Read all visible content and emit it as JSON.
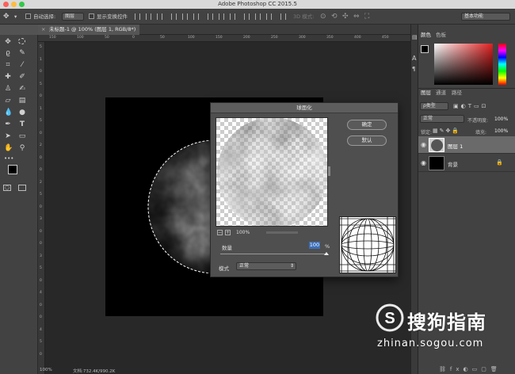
{
  "app": {
    "window_title": "Adobe Photoshop CC 2015.5"
  },
  "options_bar": {
    "auto_select_label": "自动选择:",
    "auto_select_value": "图层",
    "show_transform_label": "显示变换控件",
    "mode_3d_label": "3D 模式:",
    "workspace": "基本功能"
  },
  "document_tab": {
    "title": "未标题-1 @ 100% (图层 1, RGB/8*) *"
  },
  "rulers": {
    "h_ticks": [
      "150",
      "100",
      "50",
      "0",
      "50",
      "100",
      "150",
      "200",
      "250",
      "300",
      "350",
      "400",
      "450"
    ],
    "v_ticks": [
      "5",
      "1",
      "0",
      "5",
      "0",
      "1",
      "5",
      "0",
      "2",
      "0",
      "0",
      "2",
      "5",
      "0",
      "3",
      "0",
      "0",
      "3",
      "5",
      "0",
      "4",
      "0",
      "0",
      "4",
      "5",
      "0"
    ]
  },
  "dialog": {
    "title": "球面化",
    "ok_label": "确定",
    "reset_label": "默认",
    "zoom_level": "100%",
    "amount_label": "数量",
    "amount_value": "100",
    "amount_unit": "%",
    "mode_label": "模式",
    "mode_value": "正常"
  },
  "color_panel": {
    "tab_color": "颜色",
    "tab_swatches": "色板",
    "accent": "#e02020"
  },
  "layers_panel": {
    "tab_layers": "图层",
    "tab_channels": "通道",
    "tab_paths": "路径",
    "filter_kind": "ρ类型",
    "blend_mode": "正常",
    "opacity_label": "不透明度:",
    "opacity_value": "100%",
    "lock_label": "锁定:",
    "fill_label": "填充:",
    "fill_value": "100%",
    "layers": [
      {
        "name": "图层 1",
        "selected": true
      },
      {
        "name": "背景",
        "selected": false
      }
    ]
  },
  "status": {
    "zoom": "100%",
    "doc_info": "文档:732.4K/990.2K"
  },
  "watermark": {
    "brand": "搜狗指南",
    "url": "zhinan.sogou.com"
  }
}
